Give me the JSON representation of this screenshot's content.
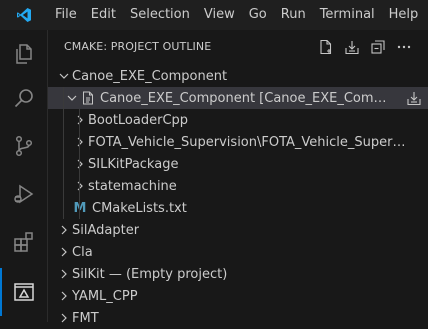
{
  "menu": {
    "items": [
      "File",
      "Edit",
      "Selection",
      "View",
      "Go",
      "Run",
      "Terminal",
      "Help"
    ]
  },
  "colors": {
    "accent": "#0078d4",
    "vscode_logo": "#23a9f2",
    "background": "#181818",
    "selected_row": "#37373d",
    "cmake_icon": "#519aba"
  },
  "activity_bar": {
    "icons": [
      "explorer-icon",
      "search-icon",
      "source-control-icon",
      "run-debug-icon",
      "extensions-icon",
      "cmake-icon"
    ]
  },
  "panel": {
    "title": "CMAKE: PROJECT OUTLINE",
    "actions": [
      "new-file-icon",
      "build-all-icon",
      "collapse-all-icon",
      "more-actions-icon"
    ]
  },
  "tree": {
    "root": {
      "label": "Canoe_EXE_Component",
      "expanded": true
    },
    "project": {
      "label": "Canoe_EXE_Component [Canoe_EXE_Compone...",
      "expanded": true
    },
    "children": [
      {
        "label": "BootLoaderCpp"
      },
      {
        "label": "FOTA_Vehicle_Supervision\\FOTA_Vehicle_Supervision..."
      },
      {
        "label": "SILKitPackage"
      },
      {
        "label": "statemachine"
      }
    ],
    "cmakelists": {
      "label": "CMakeLists.txt",
      "icon_letter": "M"
    },
    "siblings": [
      {
        "label": "SilAdapter"
      },
      {
        "label": "Cla"
      },
      {
        "label": "SilKit — (Empty project)"
      },
      {
        "label": "YAML_CPP"
      },
      {
        "label": "FMT"
      }
    ]
  }
}
